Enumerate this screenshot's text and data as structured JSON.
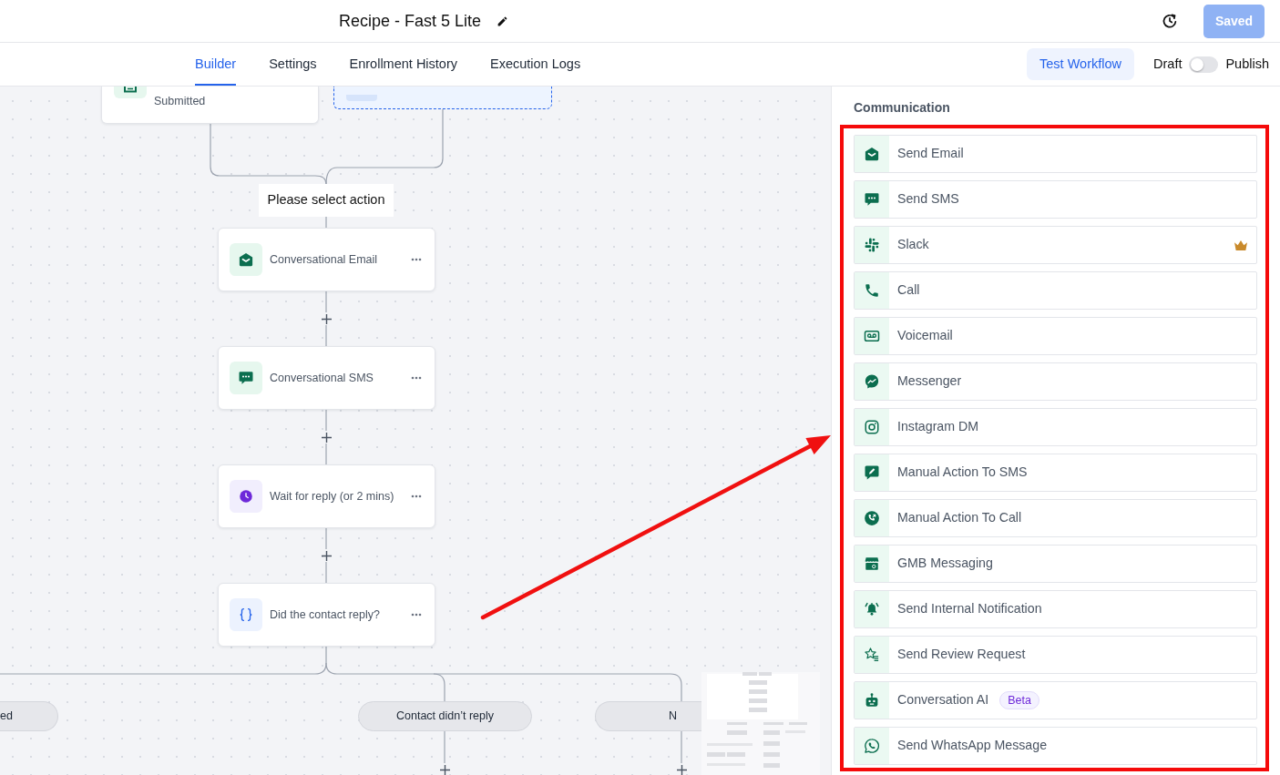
{
  "header": {
    "title": "Recipe - Fast 5 Lite",
    "save_button": "Saved"
  },
  "tabs": [
    {
      "label": "Builder",
      "selected": true
    },
    {
      "label": "Settings",
      "selected": false
    },
    {
      "label": "Enrollment History",
      "selected": false
    },
    {
      "label": "Execution Logs",
      "selected": false
    }
  ],
  "toolbar": {
    "test_button": "Test Workflow",
    "toggle": {
      "off_label": "Draft",
      "on_label": "Publish",
      "on": false
    }
  },
  "canvas": {
    "trigger": {
      "label": "Submitted"
    },
    "connector_label": "Please select action",
    "steps": [
      {
        "label": "Conversational Email",
        "kind": "email"
      },
      {
        "label": "Conversational SMS",
        "kind": "sms"
      },
      {
        "label": "Wait for reply (or 2 mins)",
        "kind": "wait"
      },
      {
        "label": "Did the contact reply?",
        "kind": "condition"
      }
    ],
    "branches": [
      {
        "label": "ed"
      },
      {
        "label": "Contact didn’t reply"
      },
      {
        "label": "N"
      }
    ],
    "pointer_arrow": true
  },
  "panel": {
    "heading": "Communication",
    "highlighted": true,
    "actions": [
      {
        "label": "Send Email",
        "kind": "email",
        "premium": false
      },
      {
        "label": "Send SMS",
        "kind": "sms",
        "premium": false
      },
      {
        "label": "Slack",
        "kind": "slack",
        "premium": true
      },
      {
        "label": "Call",
        "kind": "call",
        "premium": false
      },
      {
        "label": "Voicemail",
        "kind": "voicemail",
        "premium": false
      },
      {
        "label": "Messenger",
        "kind": "messenger",
        "premium": false
      },
      {
        "label": "Instagram DM",
        "kind": "instagram",
        "premium": false
      },
      {
        "label": "Manual Action To SMS",
        "kind": "manual_sms",
        "premium": false
      },
      {
        "label": "Manual Action To Call",
        "kind": "manual_call",
        "premium": false
      },
      {
        "label": "GMB Messaging",
        "kind": "gmb",
        "premium": false
      },
      {
        "label": "Send Internal Notification",
        "kind": "notification",
        "premium": false
      },
      {
        "label": "Send Review Request",
        "kind": "review",
        "premium": false
      },
      {
        "label": "Conversation AI",
        "kind": "ai",
        "premium": false,
        "badge": "Beta"
      },
      {
        "label": "Send WhatsApp Message",
        "kind": "whatsapp",
        "premium": false
      }
    ]
  }
}
